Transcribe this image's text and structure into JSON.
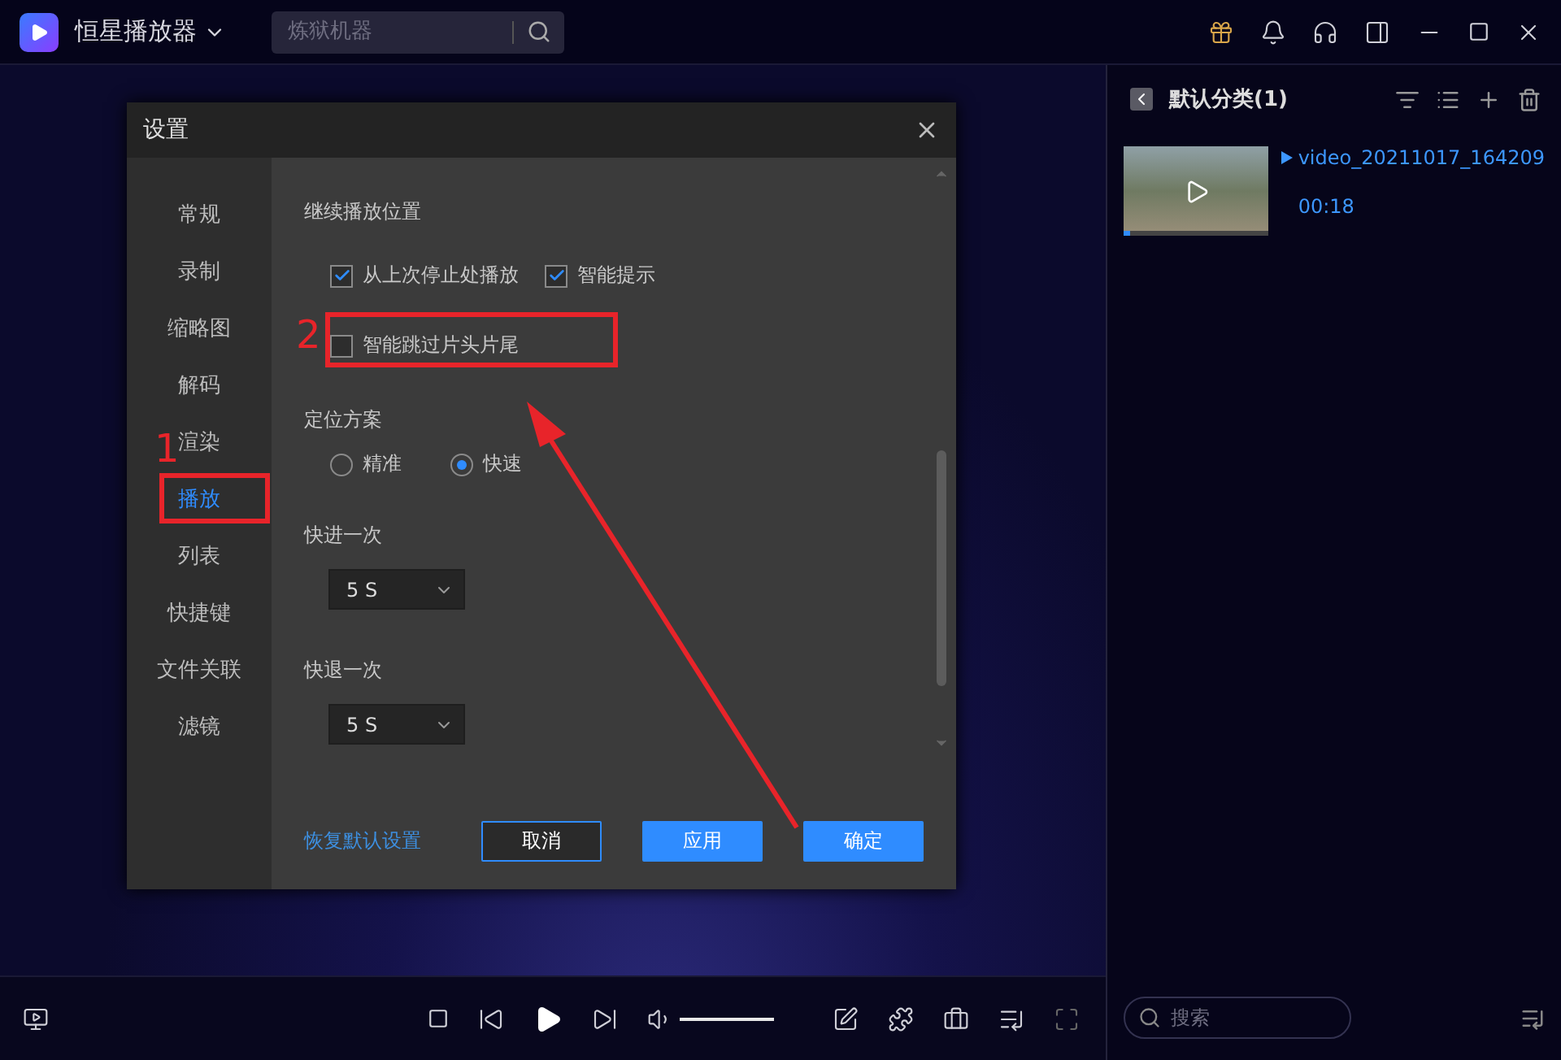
{
  "app": {
    "title": "恒星播放器",
    "search": {
      "placeholder": "炼狱机器"
    }
  },
  "playlist": {
    "title": "默认分类(1)",
    "items": [
      {
        "name": "video_20211017_164209",
        "duration": "00:18",
        "level": 0.05
      }
    ],
    "search": {
      "placeholder": "搜索"
    }
  },
  "dialog": {
    "title": "设置",
    "nav": [
      {
        "label": "常规",
        "selected": false
      },
      {
        "label": "录制",
        "selected": false
      },
      {
        "label": "缩略图",
        "selected": false
      },
      {
        "label": "解码",
        "selected": false
      },
      {
        "label": "渲染",
        "selected": false
      },
      {
        "label": "播放",
        "selected": true
      },
      {
        "label": "列表",
        "selected": false
      },
      {
        "label": "快捷键",
        "selected": false
      },
      {
        "label": "文件关联",
        "selected": false
      },
      {
        "label": "滤镜",
        "selected": false
      }
    ],
    "resume": {
      "title": "继续播放位置",
      "options": [
        {
          "label": "从上次停止处播放",
          "checked": true
        },
        {
          "label": "智能提示",
          "checked": true
        }
      ],
      "skip": {
        "label": "智能跳过片头片尾",
        "checked": false
      }
    },
    "seek": {
      "title": "定位方案",
      "options": [
        {
          "label": "精准",
          "selected": false
        },
        {
          "label": "快速",
          "selected": true
        }
      ]
    },
    "forward": {
      "title": "快进一次",
      "value": "5 S"
    },
    "backward": {
      "title": "快退一次",
      "value": "5 S"
    },
    "restore": "恢复默认设置",
    "buttons": [
      {
        "label": "取消",
        "kind": "outline"
      },
      {
        "label": "应用",
        "kind": "primary"
      },
      {
        "label": "确定",
        "kind": "primary"
      }
    ]
  },
  "annotations": [
    {
      "number": "1"
    },
    {
      "number": "2"
    }
  ],
  "player": {
    "volume": {
      "level": 1
    }
  }
}
